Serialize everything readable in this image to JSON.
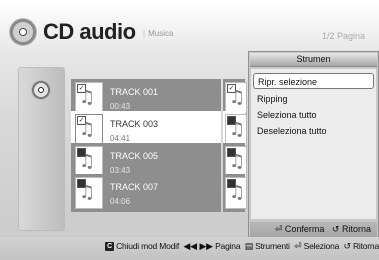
{
  "header": {
    "title": "CD audio",
    "subtitle": "Musica",
    "page_indicator": "1/2 Pagina"
  },
  "tracks": [
    {
      "name": "TRACK 001",
      "duration": "00:43",
      "checked": true,
      "selected": false
    },
    {
      "name": "TRACK 003",
      "duration": "04:41",
      "checked": true,
      "selected": true
    },
    {
      "name": "TRACK 005",
      "duration": "03:43",
      "checked": false,
      "selected": false
    },
    {
      "name": "TRACK 007",
      "duration": "04:06",
      "checked": false,
      "selected": false
    }
  ],
  "popup": {
    "title": "Strumen",
    "items": [
      "Ripr. selezione",
      "Ripping",
      "Seleziona tutto",
      "Deseleziona tutto"
    ],
    "active_index": 0,
    "footer": {
      "confirm": "Conferma",
      "back": "Ritorna"
    }
  },
  "footer": {
    "key_c": "C",
    "exit_label": "Chiudi mod Modif",
    "page_label": "Pagina",
    "tools_label": "Strumenti",
    "select_label": "Seleziona",
    "back_label": "Ritorna"
  },
  "icons": [
    "disc-icon",
    "music-note-icon",
    "checkbox-icon",
    "enter-icon",
    "return-icon",
    "skip-icon",
    "tools-icon"
  ]
}
